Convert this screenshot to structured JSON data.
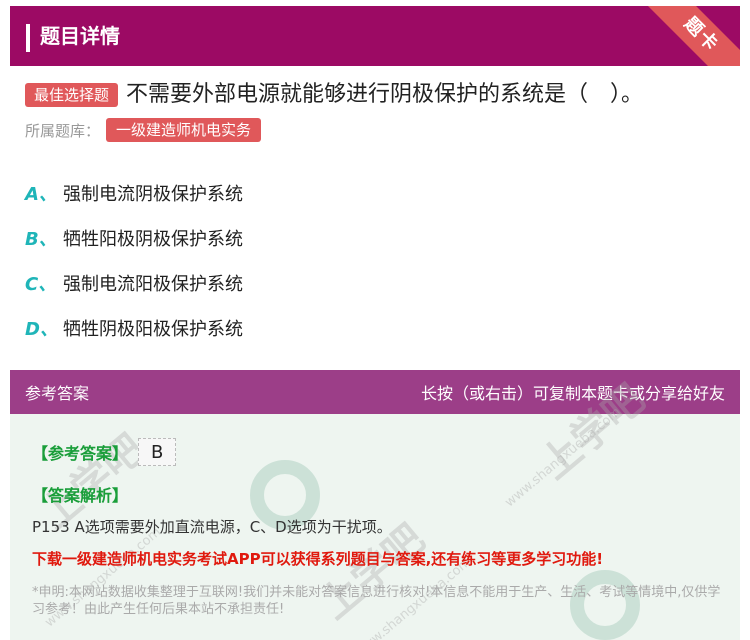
{
  "header": {
    "title": "题目详情",
    "ribbon": "题卡"
  },
  "question": {
    "type_tag": "最佳选择题",
    "text": "不需要外部电源就能够进行阴极保护的系统是（　）。",
    "bank_label": "所属题库：",
    "bank_name": "一级建造师机电实务"
  },
  "options": [
    {
      "letter": "A、",
      "text": "强制电流阴极保护系统"
    },
    {
      "letter": "B、",
      "text": "牺牲阳极阴极保护系统"
    },
    {
      "letter": "C、",
      "text": "强制电流阳极保护系统"
    },
    {
      "letter": "D、",
      "text": "牺牲阴极阳极保护系统"
    }
  ],
  "answer": {
    "header_left": "参考答案",
    "header_right": "长按（或右击）可复制本题卡或分享给好友",
    "ref_label": "【参考答案】",
    "ref_value": "B",
    "analysis_label": "【答案解析】",
    "explanation": "P153 A选项需要外加直流电源，C、D选项为干扰项。",
    "promo": "下载一级建造师机电实务考试APP可以获得系列题目与答案,还有练习等更多学习功能!",
    "disclaimer": "*申明:本网站数据收集整理于互联网!我们并未能对答案信息进行核对!本信息不能用于生产、生活、考试等情境中,仅供学习参考！由此产生任何后果本站不承担责任!"
  },
  "watermark": {
    "brand": "上学吧",
    "url": "www.shangxueba.com"
  },
  "colors": {
    "header_bg": "#9c0a64",
    "answer_header_bg": "#9c3e88",
    "tag_red": "#e0585a",
    "option_letter": "#1fb5b8",
    "green_label": "#1a9e3a",
    "promo_red": "#e0190e"
  }
}
